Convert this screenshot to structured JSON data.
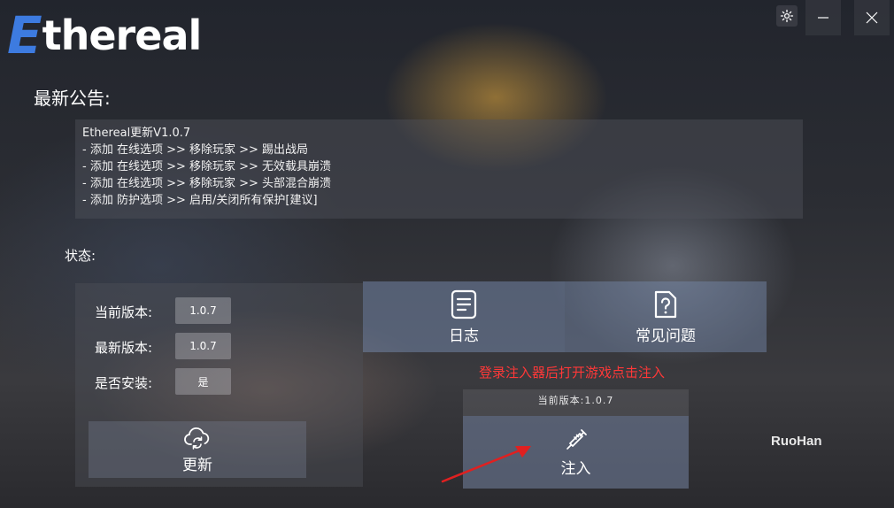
{
  "app": {
    "logo_first": "E",
    "logo_rest": "thereal",
    "accent_color": "#3d7be0"
  },
  "titlebar": {
    "settings_icon": "gear-icon",
    "minimize_icon": "minimize-icon",
    "close_icon": "close-icon"
  },
  "announcement": {
    "heading": "最新公告:",
    "lines": [
      "Ethereal更新V1.0.7",
      "- 添加 在线选项 >> 移除玩家 >> 踢出战局",
      "- 添加 在线选项 >> 移除玩家 >> 无效载具崩溃",
      "- 添加 在线选项 >> 移除玩家 >> 头部混合崩溃",
      "- 添加 防护选项 >> 启用/关闭所有保护[建议]"
    ]
  },
  "status": {
    "label": "状态:",
    "rows": [
      {
        "label": "当前版本:",
        "value": "1.0.7"
      },
      {
        "label": "最新版本:",
        "value": "1.0.7"
      },
      {
        "label": "是否安装:",
        "value": "是"
      }
    ],
    "update_button": "更新",
    "update_icon": "cloud-refresh-icon"
  },
  "tiles": {
    "log": {
      "label": "日志",
      "icon": "document-icon"
    },
    "faq": {
      "label": "常见问题",
      "icon": "question-file-icon"
    }
  },
  "inject": {
    "hint": "登录注入器后打开游戏点击注入",
    "hint_color": "#ff3838",
    "version": "当前版本:1.0.7",
    "button": "注入",
    "icon": "syringe-icon"
  },
  "author": "RuoHan"
}
